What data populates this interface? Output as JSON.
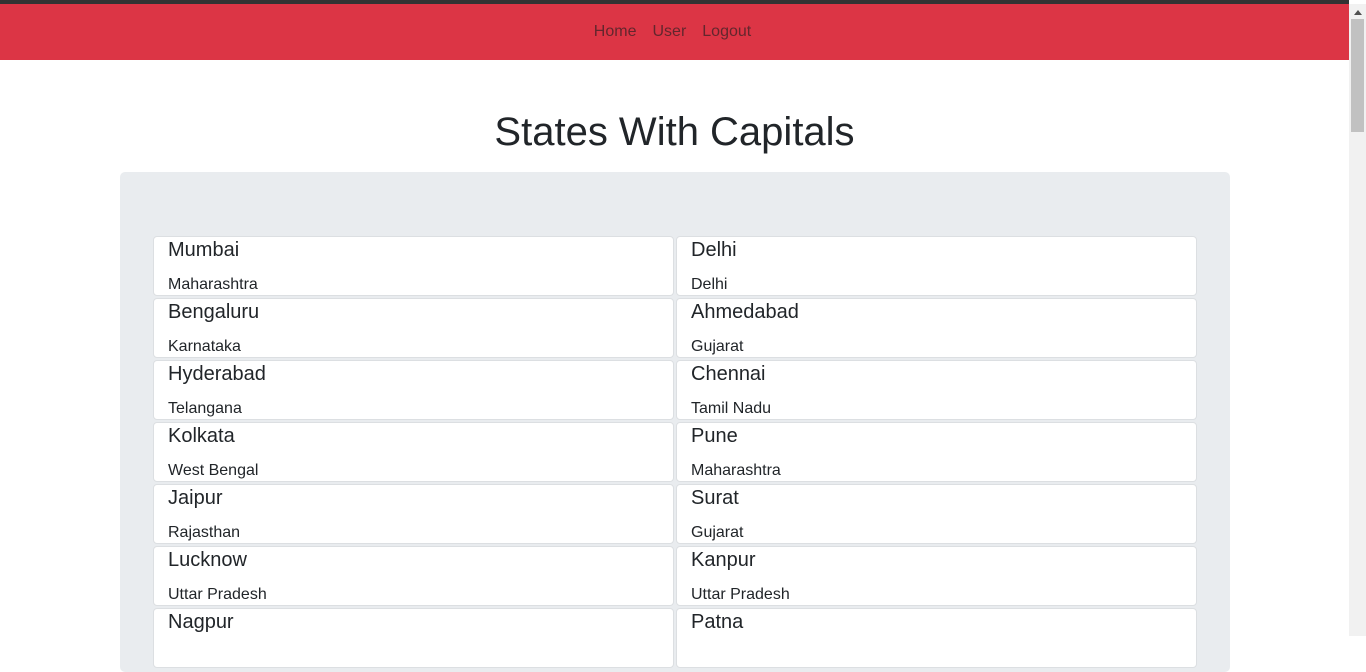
{
  "nav": {
    "links": [
      {
        "label": "Home"
      },
      {
        "label": "User"
      },
      {
        "label": "Logout"
      }
    ]
  },
  "page": {
    "title": "States With Capitals"
  },
  "capitals": [
    {
      "city": "Mumbai",
      "state": "Maharashtra"
    },
    {
      "city": "Delhi",
      "state": "Delhi"
    },
    {
      "city": "Bengaluru",
      "state": "Karnataka"
    },
    {
      "city": "Ahmedabad",
      "state": "Gujarat"
    },
    {
      "city": "Hyderabad",
      "state": "Telangana"
    },
    {
      "city": "Chennai",
      "state": "Tamil Nadu"
    },
    {
      "city": "Kolkata",
      "state": "West Bengal"
    },
    {
      "city": "Pune",
      "state": "Maharashtra"
    },
    {
      "city": "Jaipur",
      "state": "Rajasthan"
    },
    {
      "city": "Surat",
      "state": "Gujarat"
    },
    {
      "city": "Lucknow",
      "state": "Uttar Pradesh"
    },
    {
      "city": "Kanpur",
      "state": "Uttar Pradesh"
    },
    {
      "city": "Nagpur",
      "state": ""
    },
    {
      "city": "Patna",
      "state": ""
    }
  ],
  "colors": {
    "navbar": "#dc3545",
    "panel": "#e9ecef"
  }
}
